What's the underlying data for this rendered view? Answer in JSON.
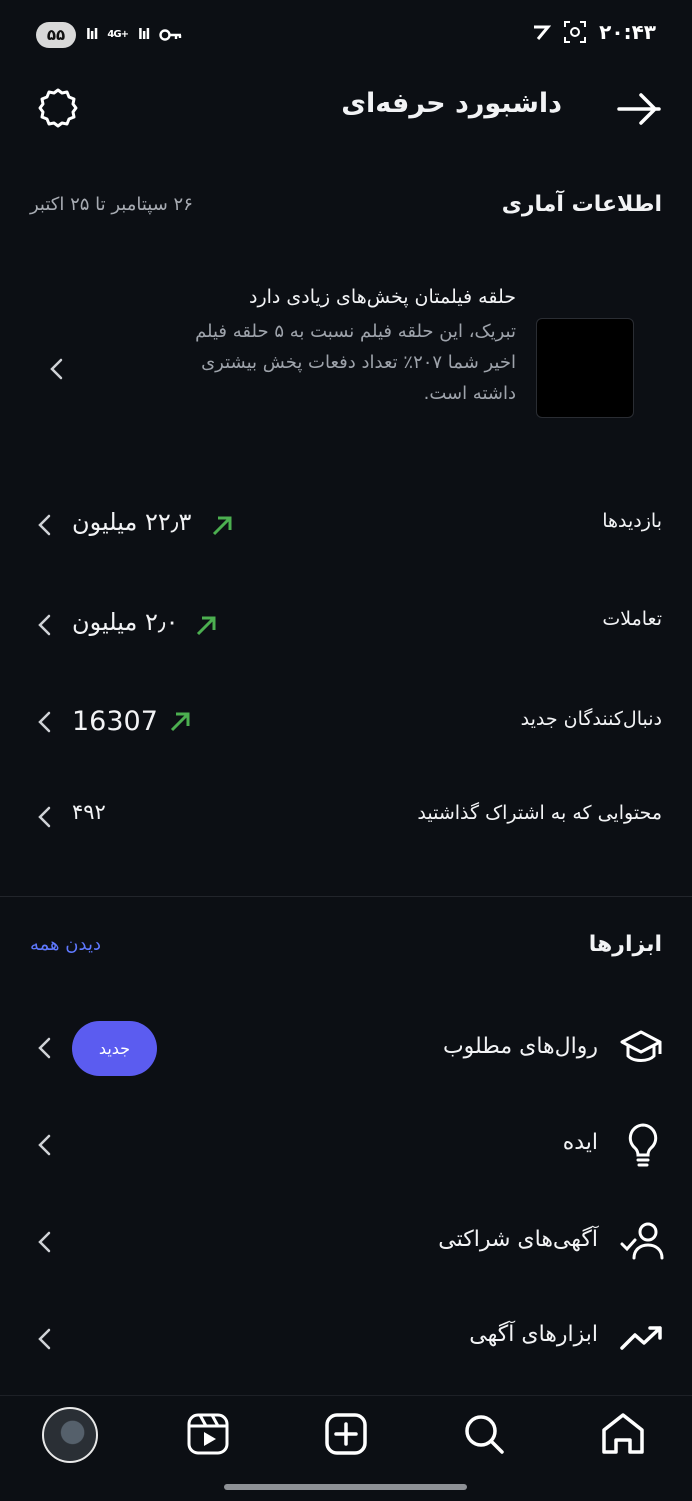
{
  "status_bar": {
    "battery": "۵۵",
    "net": "4G+",
    "time": "۲۰:۴۳"
  },
  "header": {
    "title": "داشبورد حرفه‌ای"
  },
  "stats": {
    "title": "اطلاعات آماری",
    "date_range": "۲۶ سپتامبر تا ۲۵ اکتبر",
    "highlight": {
      "title": "حلقه فیلمتان پخش‌های زیادی دارد",
      "body": "تبریک، این حلقه فیلم نسبت به ۵ حلقه فیلم اخیر شما ۲۰۷٪ تعداد دفعات پخش بیشتری داشته است."
    },
    "rows": [
      {
        "label": "بازدیدها",
        "value": "۲۲٫۳ میلیون",
        "trend": "up"
      },
      {
        "label": "تعاملات",
        "value": "۲٫۰ میلیون",
        "trend": "up"
      },
      {
        "label": "دنبال‌کنندگان جدید",
        "value": "16307",
        "trend": "up"
      },
      {
        "label": "محتوایی که به اشتراک گذاشتید",
        "value": "۴۹۲"
      }
    ]
  },
  "tools": {
    "title": "ابزارها",
    "see_all": "دیدن همه",
    "items": [
      {
        "label": "روال‌های مطلوب",
        "icon": "graduation-cap-icon",
        "badge": "جدید"
      },
      {
        "label": "ایده",
        "icon": "lightbulb-icon"
      },
      {
        "label": "آگهی‌های شراکتی",
        "icon": "user-check-icon"
      },
      {
        "label": "ابزارهای آگهی",
        "icon": "trending-up-icon"
      }
    ]
  },
  "nav": [
    "home-icon",
    "search-icon",
    "create-icon",
    "reels-icon",
    "profile-avatar"
  ],
  "colors": {
    "accent": "#5b5cf0",
    "trend_up": "#4caf50",
    "link": "#5f79ff"
  }
}
